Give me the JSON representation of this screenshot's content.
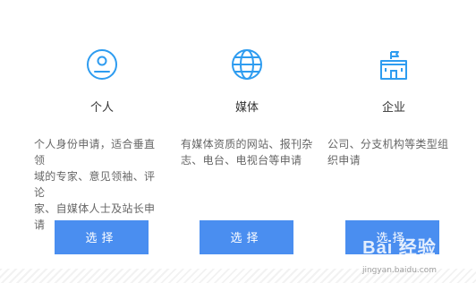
{
  "accent_color": "#4a8ef0",
  "cards": [
    {
      "icon": "user-circle-icon",
      "title": "个人",
      "desc_lines": [
        "个人身份申请，适合垂直领",
        "域的专家、意见领袖、评论",
        "家、自媒体人士及站长申请"
      ],
      "button_label": "选择"
    },
    {
      "icon": "globe-icon",
      "title": "媒体",
      "desc_lines": [
        "有媒体资质的网站、报刊杂",
        "志、电台、电视台等申请"
      ],
      "button_label": "选择"
    },
    {
      "icon": "building-flag-icon",
      "title": "企业",
      "desc_lines": [
        "公司、分支机构等类型组",
        "织申请"
      ],
      "button_label": "选择"
    }
  ],
  "watermark": {
    "brand": "Bai 经验",
    "site": "jingyan.baidu.com"
  }
}
